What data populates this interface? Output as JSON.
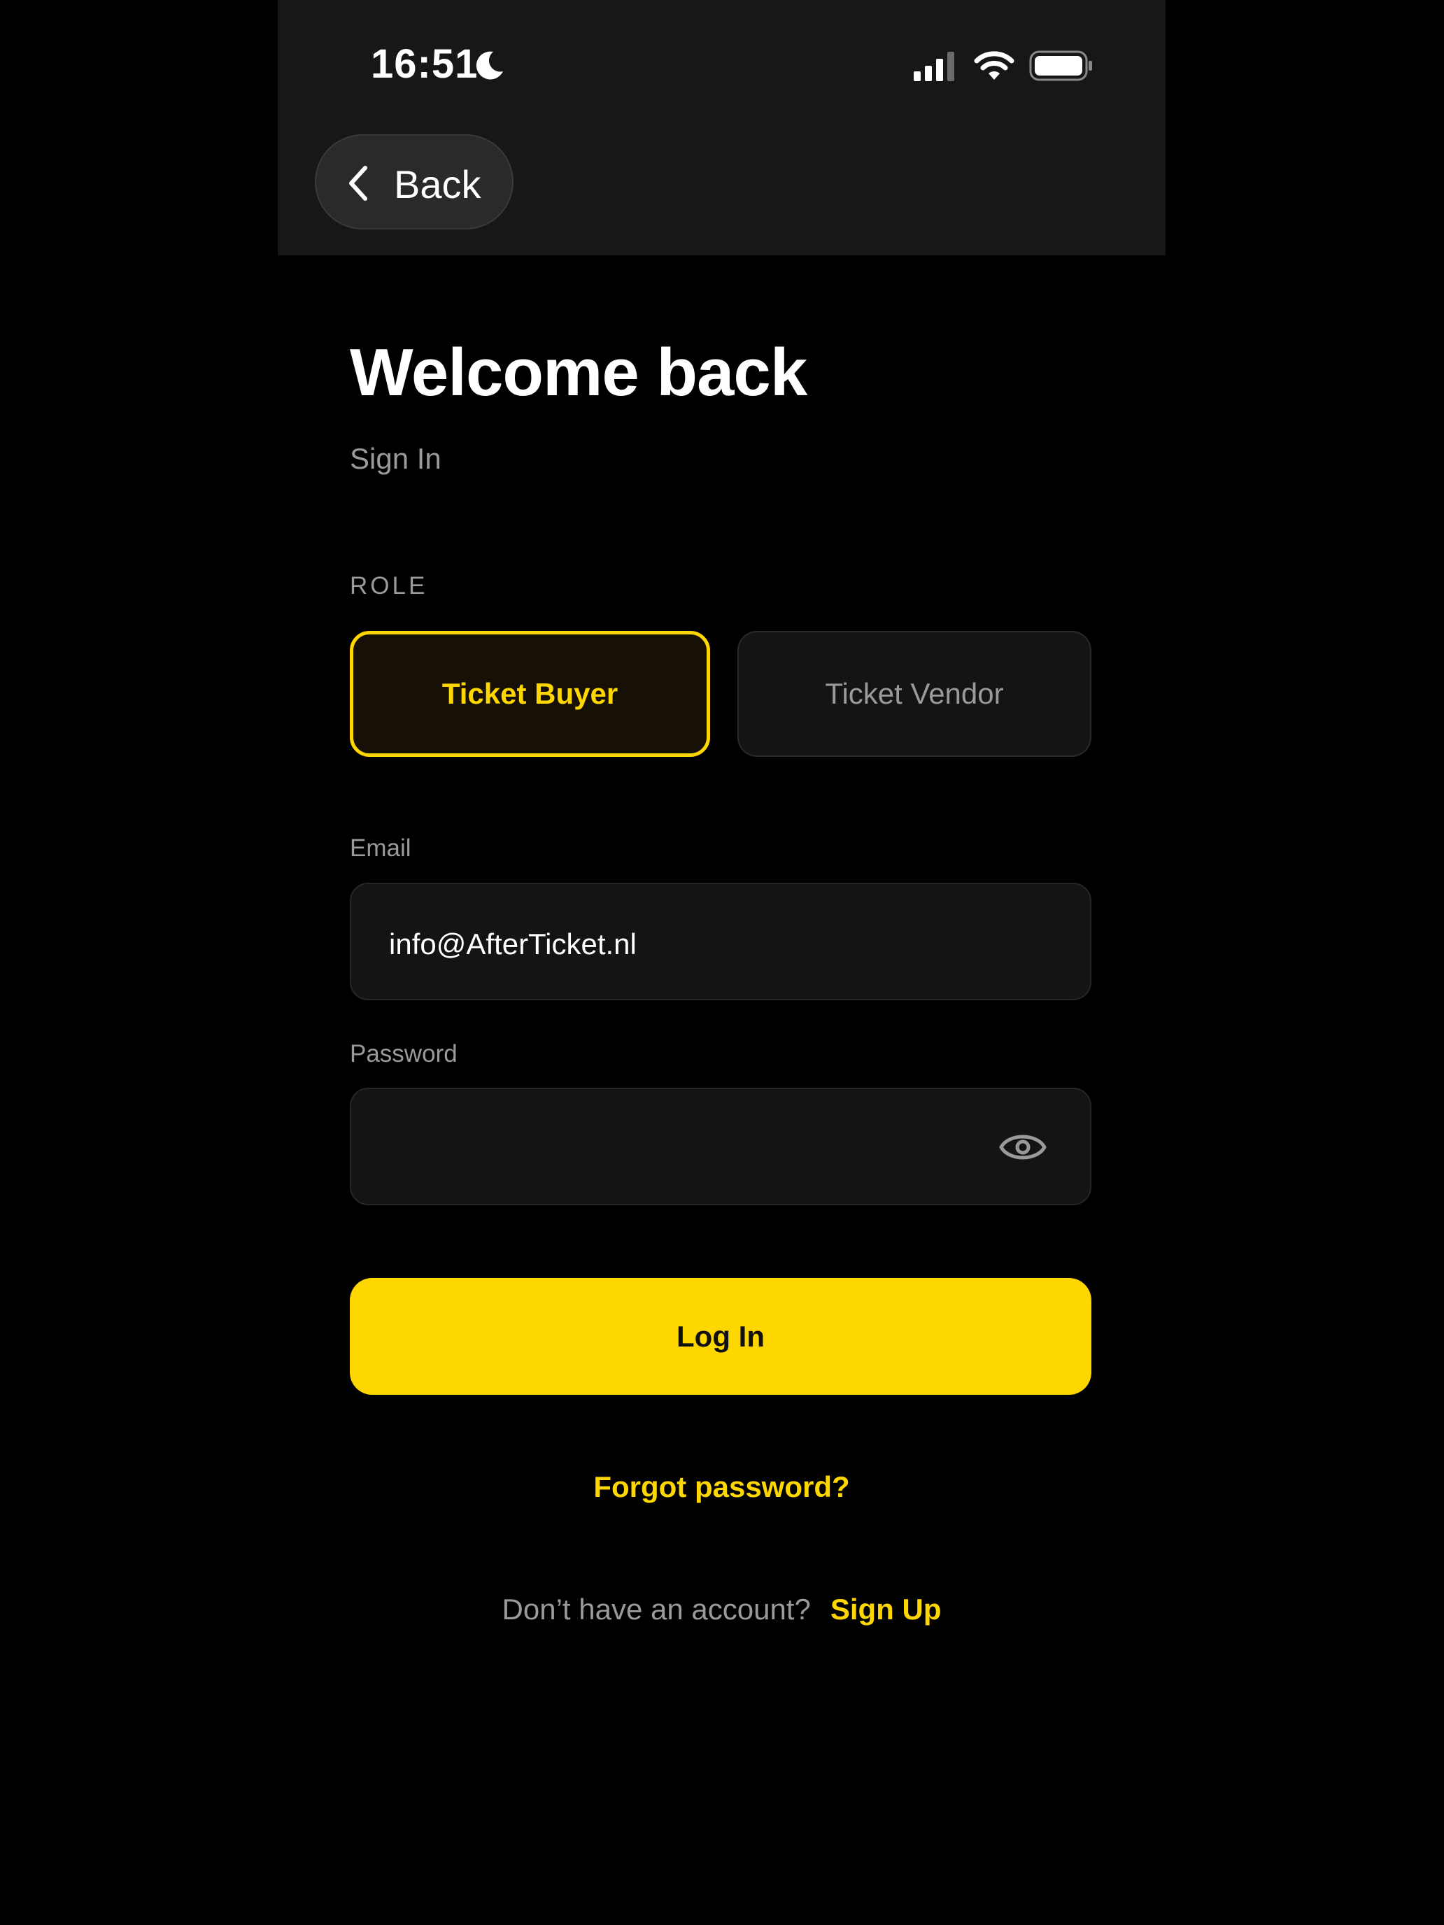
{
  "status_bar": {
    "time": "16:51",
    "icons": [
      "moon-icon",
      "signal-icon",
      "wifi-icon",
      "battery-icon"
    ]
  },
  "nav": {
    "back_label": "Back",
    "back_icon": "chevron-left-icon"
  },
  "header": {
    "title": "Welcome back",
    "subtitle": "Sign In"
  },
  "role": {
    "label": "ROLE",
    "options": [
      {
        "label": "Ticket Buyer",
        "selected": true
      },
      {
        "label": "Ticket Vendor",
        "selected": false
      }
    ]
  },
  "form": {
    "email_label": "Email",
    "email_value": "info@AfterTicket.nl",
    "password_label": "Password",
    "password_value": "",
    "password_toggle_icon": "eye-icon"
  },
  "actions": {
    "login_label": "Log In",
    "forgot_label": "Forgot password?",
    "signup_prompt": "Don’t have an account?",
    "signup_label": "Sign Up"
  },
  "colors": {
    "accent": "#FFD700",
    "background": "#000000",
    "header_bg": "#171717",
    "field_bg": "#141414",
    "muted_text": "#9a9a9a"
  }
}
